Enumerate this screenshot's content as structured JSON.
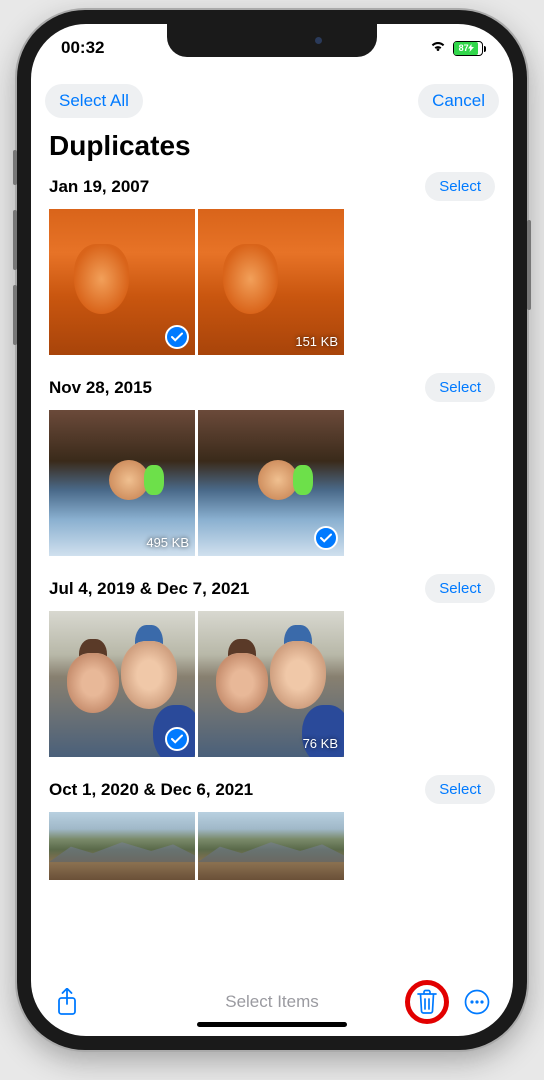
{
  "status": {
    "time": "00:32",
    "battery_pct": "87",
    "battery_fill_width": "87%"
  },
  "nav": {
    "select_all": "Select All",
    "cancel": "Cancel"
  },
  "title": "Duplicates",
  "groups": [
    {
      "date": "Jan 19, 2007",
      "select": "Select",
      "items": [
        {
          "selected": true,
          "size": ""
        },
        {
          "selected": false,
          "size": "151 KB"
        }
      ]
    },
    {
      "date": "Nov 28, 2015",
      "select": "Select",
      "items": [
        {
          "selected": false,
          "size": "495 KB"
        },
        {
          "selected": true,
          "size": ""
        }
      ]
    },
    {
      "date": "Jul 4, 2019 & Dec 7, 2021",
      "select": "Select",
      "items": [
        {
          "selected": true,
          "size": ""
        },
        {
          "selected": false,
          "size": "76 KB"
        }
      ]
    },
    {
      "date": "Oct 1, 2020 & Dec 6, 2021",
      "select": "Select",
      "items": [
        {
          "selected": false,
          "size": ""
        },
        {
          "selected": false,
          "size": ""
        }
      ]
    }
  ],
  "toolbar": {
    "hint": "Select Items"
  }
}
